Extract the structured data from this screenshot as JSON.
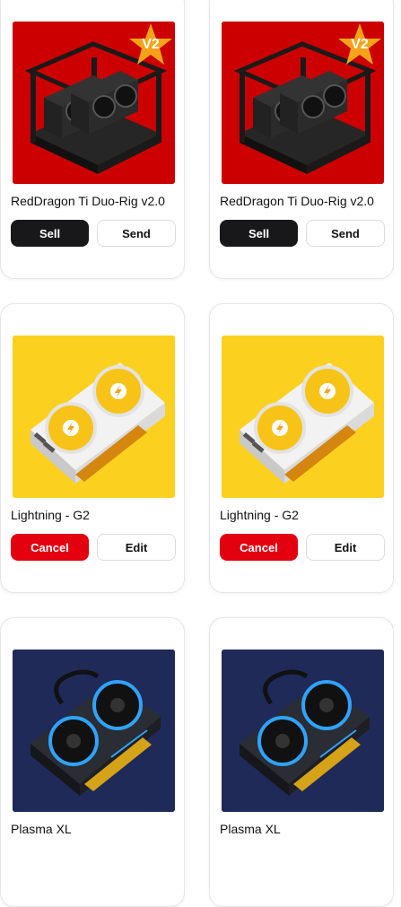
{
  "products": [
    {
      "name": "RedDragon Ti Duo-Rig v2.0",
      "badge": "V2",
      "bg_color": "#cc0000",
      "icon": "mining-rig-icon",
      "primary_label": "Sell",
      "primary_style": "dark",
      "secondary_label": "Send"
    },
    {
      "name": "RedDragon Ti Duo-Rig v2.0",
      "badge": "V2",
      "bg_color": "#cc0000",
      "icon": "mining-rig-icon",
      "primary_label": "Sell",
      "primary_style": "dark",
      "secondary_label": "Send"
    },
    {
      "name": "Lightning - G2",
      "bg_color": "#fcd01f",
      "icon": "lightning-gpu-icon",
      "primary_label": "Cancel",
      "primary_style": "red",
      "secondary_label": "Edit"
    },
    {
      "name": "Lightning - G2",
      "bg_color": "#fcd01f",
      "icon": "lightning-gpu-icon",
      "primary_label": "Cancel",
      "primary_style": "red",
      "secondary_label": "Edit"
    },
    {
      "name": "Plasma XL",
      "bg_color": "#1f2a58",
      "icon": "plasma-gpu-icon"
    },
    {
      "name": "Plasma XL",
      "bg_color": "#1f2a58",
      "icon": "plasma-gpu-icon"
    }
  ],
  "colors": {
    "dark_button": "#18181b",
    "cancel_button": "#e3000f",
    "badge_star": "#f5a31a"
  }
}
